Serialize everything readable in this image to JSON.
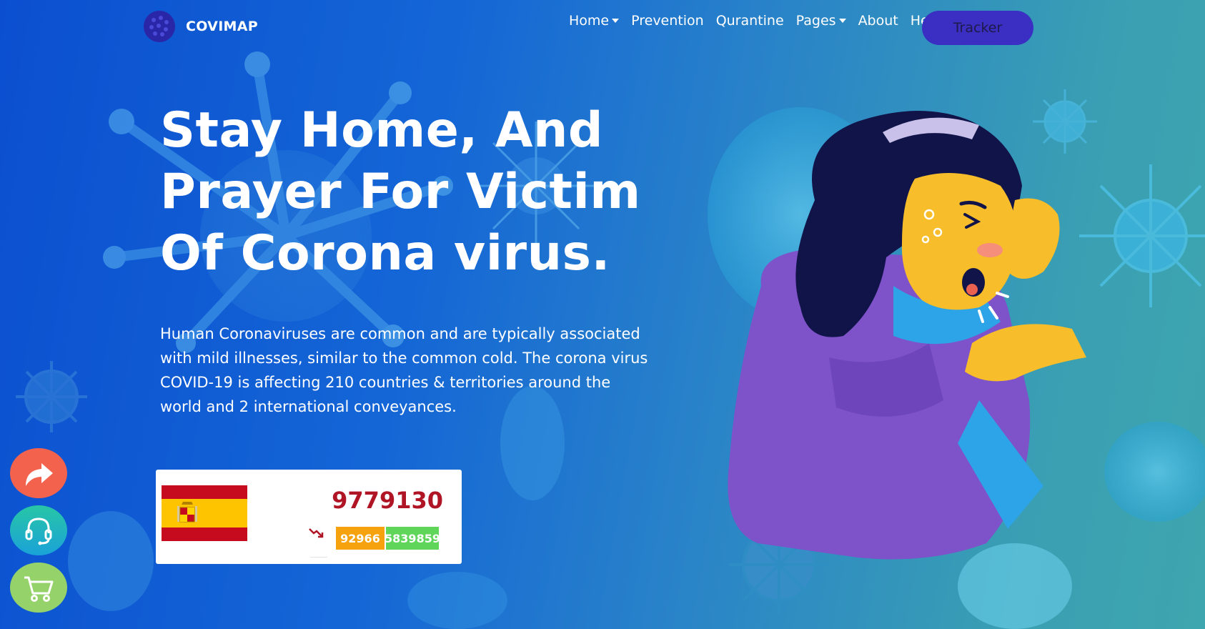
{
  "brand": {
    "name": "COVIMAP",
    "logo_icon": "virus-logo-icon"
  },
  "nav": {
    "items": [
      {
        "label": "Home",
        "dropdown": true
      },
      {
        "label": "Prevention",
        "dropdown": false
      },
      {
        "label": "Qurantine",
        "dropdown": false
      },
      {
        "label": "Pages",
        "dropdown": true
      },
      {
        "label": "About",
        "dropdown": false
      },
      {
        "label": "Help",
        "dropdown": false
      }
    ],
    "cta_label": "Tracker"
  },
  "hero": {
    "title": "Stay Home, And Prayer For Victim Of Corona virus.",
    "description": "Human Coronaviruses are common and are typically associated with mild illnesses, similar to the common cold. The corona virus COVID-19 is affecting 210 countries & territories around the world and 2 international conveyances."
  },
  "stats": {
    "country_flag_icon": "spain-flag-icon",
    "total_cases": "9779130",
    "trend_icon": "trending-down-icon",
    "deaths": "92966",
    "recovered": "5839859"
  },
  "floating_actions": [
    {
      "name": "share-button",
      "icon": "share-arrow-icon"
    },
    {
      "name": "support-button",
      "icon": "headset-icon"
    },
    {
      "name": "cart-button",
      "icon": "cart-icon"
    }
  ],
  "colors": {
    "cta_background": "#3a2fc2",
    "total_cases_text": "#b01526",
    "deaths_badge": "#f5a20e",
    "recovered_badge": "#5fd65a",
    "share_button": "#f3624d",
    "cart_button": "#96d26a"
  }
}
